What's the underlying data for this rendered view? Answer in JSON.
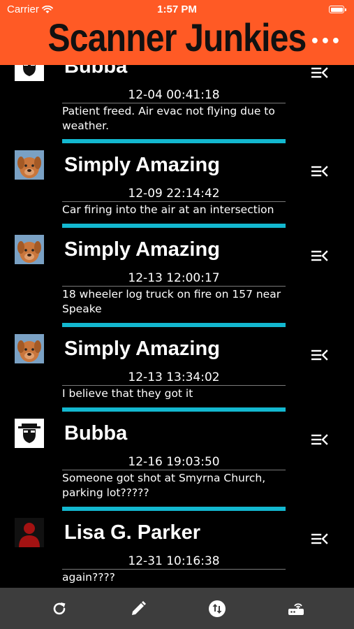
{
  "status_bar": {
    "carrier": "Carrier",
    "time": "1:57 PM"
  },
  "header": {
    "title": "Scanner Junkies",
    "more_icon": "more-dots-icon",
    "background_color": "#ff5a25"
  },
  "posts": [
    {
      "author": "Bubba",
      "avatar": "heisenberg-avatar",
      "timestamp": "12-04 00:41:18",
      "message": "Patient freed.  Air evac not flying due to weather."
    },
    {
      "author": "Simply Amazing",
      "avatar": "dog-avatar",
      "timestamp": "12-09 22:14:42",
      "message": "Car firing into the air at an intersection"
    },
    {
      "author": "Simply Amazing",
      "avatar": "dog-avatar",
      "timestamp": "12-13 12:00:17",
      "message": "18 wheeler log truck on fire on 157 near Speake"
    },
    {
      "author": "Simply Amazing",
      "avatar": "dog-avatar",
      "timestamp": "12-13 13:34:02",
      "message": "I believe that they got it"
    },
    {
      "author": "Bubba",
      "avatar": "heisenberg-avatar",
      "timestamp": "12-16 19:03:50",
      "message": "Someone got shot at Smyrna Church, parking lot?????"
    },
    {
      "author": "Lisa G. Parker",
      "avatar": "person-silhouette-avatar",
      "timestamp": "12-31 10:16:38",
      "message": "again????"
    }
  ],
  "toolbar": {
    "items": [
      "refresh-icon",
      "compose-icon",
      "sort-icon",
      "scanner-icon"
    ]
  },
  "colors": {
    "divider": "#13b8d0",
    "toolbar_bg": "#3d3d3d"
  }
}
